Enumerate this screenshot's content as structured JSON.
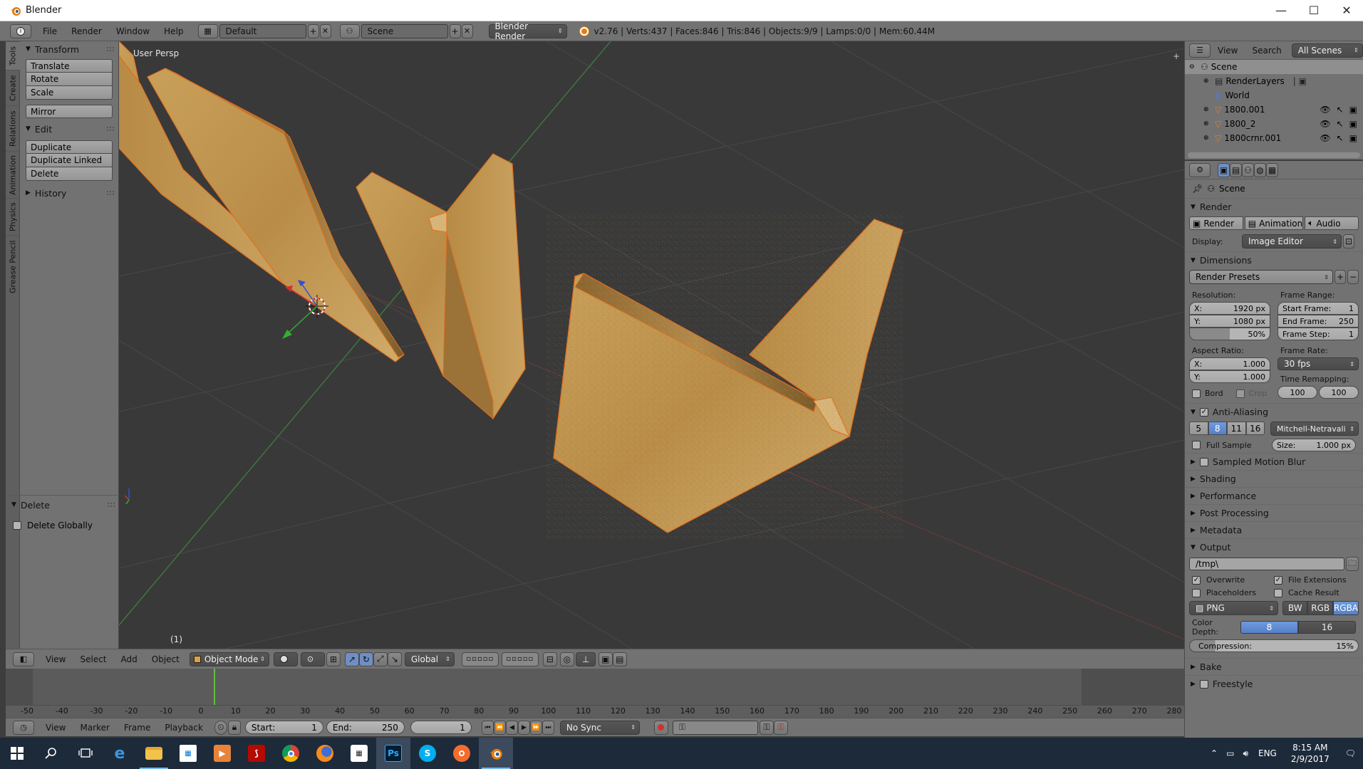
{
  "window": {
    "title": "Blender",
    "minimize": "—",
    "maximize": "☐",
    "close": "✕"
  },
  "infobar": {
    "menus": [
      "File",
      "Render",
      "Window",
      "Help"
    ],
    "layout": "Default",
    "scene": "Scene",
    "engine": "Blender Render",
    "stats": "v2.76 | Verts:437 | Faces:846 | Tris:846 | Objects:9/9 | Lamps:0/0 | Mem:60.44M"
  },
  "tool_tabs": [
    "Tools",
    "Create",
    "Relations",
    "Animation",
    "Physics",
    "Grease Pencil"
  ],
  "toolshelf": {
    "transform": {
      "title": "Transform",
      "buttons": [
        "Translate",
        "Rotate",
        "Scale"
      ],
      "mirror": "Mirror"
    },
    "edit": {
      "title": "Edit",
      "buttons": [
        "Duplicate",
        "Duplicate Linked",
        "Delete"
      ]
    },
    "history": {
      "title": "History"
    },
    "delete_panel": {
      "title": "Delete",
      "checkbox": "Delete Globally"
    }
  },
  "viewport": {
    "label": "User Persp",
    "frame": "(1)"
  },
  "vp_header": {
    "menus": [
      "View",
      "Select",
      "Add",
      "Object"
    ],
    "mode": "Object Mode",
    "orientation": "Global"
  },
  "timeline": {
    "ticks": [
      "-50",
      "-40",
      "-30",
      "-20",
      "-10",
      "0",
      "10",
      "20",
      "30",
      "40",
      "50",
      "60",
      "70",
      "80",
      "90",
      "100",
      "110",
      "120",
      "130",
      "140",
      "150",
      "160",
      "170",
      "180",
      "190",
      "200",
      "210",
      "220",
      "230",
      "240",
      "250",
      "260",
      "270",
      "280"
    ],
    "menus": [
      "View",
      "Marker",
      "Frame",
      "Playback"
    ],
    "start_label": "Start:",
    "start": "1",
    "end_label": "End:",
    "end": "250",
    "current": "1",
    "sync": "No Sync"
  },
  "outliner": {
    "menus": [
      "View",
      "Search"
    ],
    "filter": "All Scenes",
    "rows": [
      {
        "label": "Scene",
        "indent": 0
      },
      {
        "label": "RenderLayers",
        "indent": 1
      },
      {
        "label": "World",
        "indent": 1
      },
      {
        "label": "1800.001",
        "indent": 1
      },
      {
        "label": "1800_2",
        "indent": 1
      },
      {
        "label": "1800crnr.001",
        "indent": 1
      }
    ]
  },
  "properties": {
    "context": "Scene",
    "render": {
      "title": "Render",
      "tabs": [
        "Render",
        "Animation",
        "Audio"
      ],
      "display_label": "Display:",
      "display_value": "Image Editor"
    },
    "dimensions": {
      "title": "Dimensions",
      "presets": "Render Presets",
      "resolution_label": "Resolution:",
      "res_x": "1920 px",
      "res_y": "1080 px",
      "res_pct": "50%",
      "frame_range_label": "Frame Range:",
      "start_frame": "1",
      "end_frame": "250",
      "frame_step": "1",
      "aspect_label": "Aspect Ratio:",
      "aspect_x": "1.000",
      "aspect_y": "1.000",
      "frame_rate_label": "Frame Rate:",
      "frame_rate": "30 fps",
      "time_remap_label": "Time Remapping:",
      "remap_old": "100",
      "remap_new": "100",
      "bord": "Bord",
      "crop": "Crop"
    },
    "antialiasing": {
      "title": "Anti-Aliasing",
      "samples": [
        "5",
        "8",
        "11",
        "16"
      ],
      "active_sample": "8",
      "filter": "Mitchell-Netravali",
      "full_sample": "Full Sample",
      "size_label": "Size:",
      "size": "1.000 px"
    },
    "collapsed": [
      "Sampled Motion Blur",
      "Shading",
      "Performance",
      "Post Processing",
      "Metadata"
    ],
    "output": {
      "title": "Output",
      "path": "/tmp\\",
      "overwrite": "Overwrite",
      "file_extensions": "File Extensions",
      "placeholders": "Placeholders",
      "cache_result": "Cache Result",
      "format": "PNG",
      "channels": [
        "BW",
        "RGB",
        "RGBA"
      ],
      "color_depth_label": "Color Depth:",
      "depths": [
        "8",
        "16"
      ],
      "compression_label": "Compression:",
      "compression": "15%"
    },
    "bake": "Bake",
    "freestyle": "Freestyle"
  },
  "taskbar": {
    "lang": "ENG",
    "time": "8:15 AM",
    "date": "2/9/2017",
    "ps": "Ps",
    "skype": "S"
  }
}
